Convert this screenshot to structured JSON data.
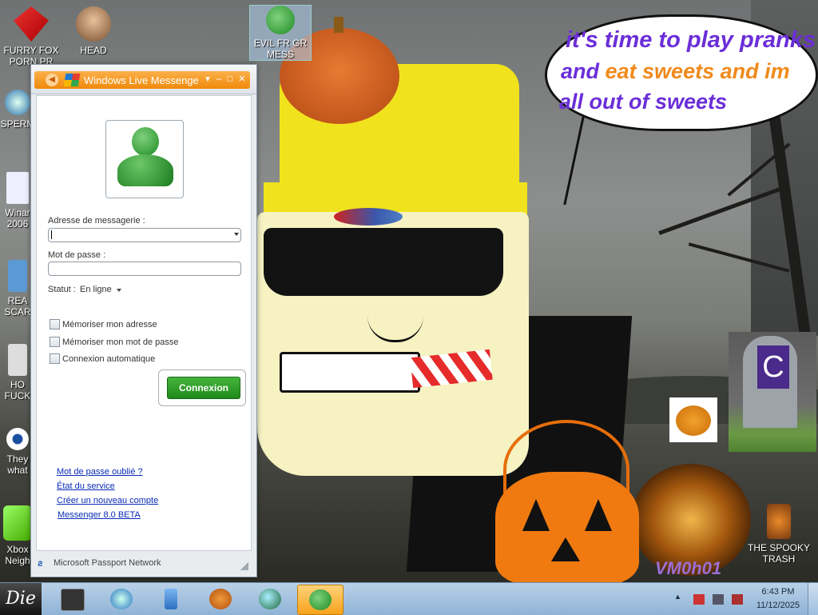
{
  "desktop_icons": [
    {
      "label": "FURRY FOX PORN PR",
      "icon": "fox-icon"
    },
    {
      "label": "HEAD",
      "icon": "head-icon"
    },
    {
      "label": "EVIL FR GR MESS",
      "icon": "messenger-icon"
    },
    {
      "label": "SPERM",
      "icon": "browser-icon"
    },
    {
      "label": "Winar 2006",
      "icon": "document-icon"
    },
    {
      "label": "REA SCAR",
      "icon": "app-icon"
    },
    {
      "label": "HO FUCK",
      "icon": "app-icon"
    },
    {
      "label": "They what",
      "icon": "eye-icon"
    },
    {
      "label": "Xbox Neigh",
      "icon": "xbox-icon"
    },
    {
      "label": "THE SPOOKY TRASH",
      "icon": "trash-icon"
    }
  ],
  "wallpaper": {
    "speech_lines": [
      {
        "text": "it's time to play pranks",
        "color": "#6b2ed8"
      },
      {
        "parts": [
          {
            "text": "and ",
            "color": "#6b2ed8"
          },
          {
            "text": "eat sweets and im",
            "color": "#f08a1c"
          }
        ]
      },
      {
        "text": "all out of sweets",
        "color": "#6b2ed8"
      }
    ],
    "grave_letter": "C",
    "watermark": "VM0h01"
  },
  "messenger": {
    "title": "Windows Live Messenge",
    "email_label": "Adresse de messagerie :",
    "email_value": "",
    "password_label": "Mot de passe :",
    "password_value": "",
    "status_label": "Statut :",
    "status_value": "En ligne",
    "checkboxes": [
      {
        "label": "Mémoriser mon adresse",
        "checked": false
      },
      {
        "label": "Mémoriser mon mot de passe",
        "checked": false
      },
      {
        "label": "Connexion automatique",
        "checked": false
      }
    ],
    "connect_label": "Connexion",
    "links": [
      "Mot de passe oublié ?",
      "État du service",
      "Créer un nouveau compte",
      "Messenger 8.0 BETA"
    ],
    "footer": "Microsoft Passport Network",
    "colors": {
      "title_orange": "#f08a0b",
      "link": "#0a2bb5",
      "button_green": "#1f8a1a"
    }
  },
  "taskbar": {
    "start_label": "Die",
    "buttons": [
      "folder-icon",
      "browser-icon",
      "usb-icon",
      "pumpkin-icon",
      "globe-icon",
      "messenger-icon"
    ],
    "active_button": "messenger-icon",
    "time": "6:43 PM",
    "date": "11/12/2025"
  }
}
